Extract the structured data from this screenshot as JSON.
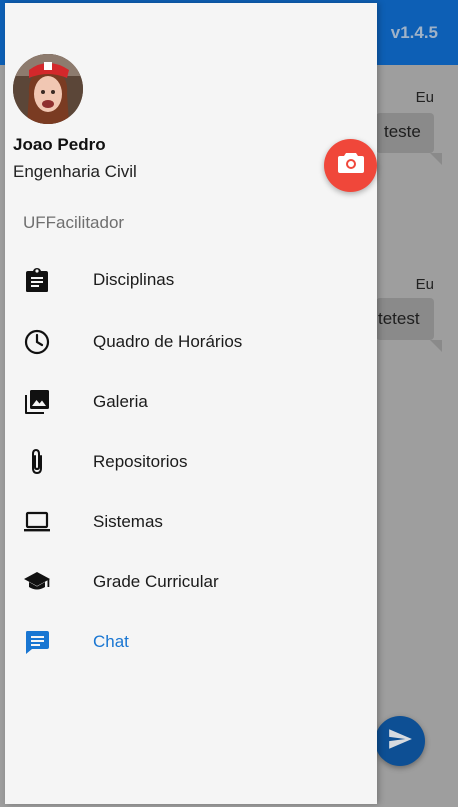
{
  "app": {
    "version": "v1.4.5"
  },
  "chat": {
    "messages": [
      {
        "author": "Eu",
        "text": "teste"
      },
      {
        "author": "Eu",
        "text": "tetest"
      }
    ]
  },
  "drawer": {
    "user": {
      "name": "Joao Pedro",
      "course": "Engenharia Civil"
    },
    "section_title": "UFFacilitador",
    "items": [
      {
        "label": "Disciplinas",
        "icon": "clipboard-icon"
      },
      {
        "label": "Quadro de Horários",
        "icon": "clock-icon"
      },
      {
        "label": "Galeria",
        "icon": "photo-library-icon"
      },
      {
        "label": "Repositorios",
        "icon": "paperclip-icon"
      },
      {
        "label": "Sistemas",
        "icon": "laptop-icon"
      },
      {
        "label": "Grade Curricular",
        "icon": "graduation-cap-icon"
      },
      {
        "label": "Chat",
        "icon": "chat-icon",
        "active": true
      }
    ]
  },
  "colors": {
    "accent": "#1976d2",
    "appbar": "#0d5fb5",
    "camera_fab": "#f0473a"
  }
}
